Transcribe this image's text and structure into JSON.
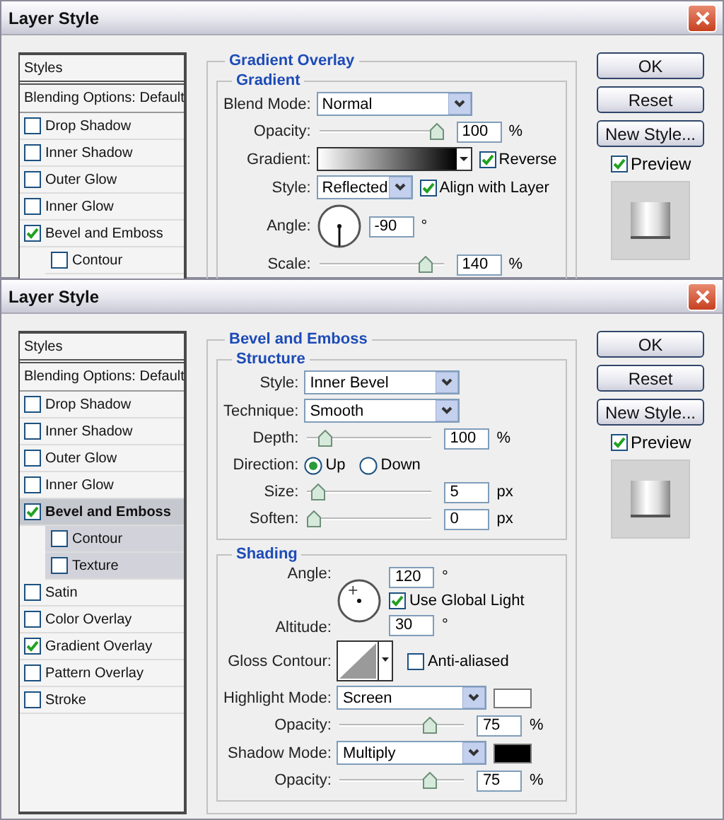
{
  "dialogs": [
    {
      "title": "Layer Style",
      "styles": [
        {
          "kind": "header",
          "label": "Styles"
        },
        {
          "kind": "plain",
          "label": "Blending Options: Default"
        },
        {
          "kind": "check",
          "label": "Drop Shadow",
          "checked": false,
          "selected": false
        },
        {
          "kind": "check",
          "label": "Inner Shadow",
          "checked": false,
          "selected": false
        },
        {
          "kind": "check",
          "label": "Outer Glow",
          "checked": false,
          "selected": false
        },
        {
          "kind": "check",
          "label": "Inner Glow",
          "checked": false,
          "selected": false
        },
        {
          "kind": "check",
          "label": "Bevel and Emboss",
          "checked": true,
          "selected": false,
          "children": [
            {
              "kind": "check",
              "label": "Contour",
              "checked": false,
              "selected": false
            }
          ]
        }
      ],
      "panel": {
        "title": "Gradient Overlay",
        "groups": [
          {
            "title": "Gradient",
            "rows": [
              {
                "kind": "select",
                "label": "Blend Mode:",
                "value": "Normal"
              },
              {
                "kind": "slider",
                "label": "Opacity:",
                "level": 1,
                "value": "100",
                "unit": "%"
              },
              {
                "kind": "gradient",
                "label": "Gradient:",
                "option": {
                  "label": "Reverse",
                  "checked": true
                }
              },
              {
                "kind": "select",
                "label": "Style:",
                "value": "Reflected",
                "option": {
                  "label": "Align with Layer",
                  "checked": true
                }
              },
              {
                "kind": "angle",
                "label": "Angle:",
                "value": "-90",
                "unit": "°"
              },
              {
                "kind": "slider",
                "label": "Scale:",
                "level": 0.9,
                "value": "140",
                "unit": "%"
              }
            ]
          }
        ]
      },
      "buttons": [
        "OK",
        "Reset",
        "New Style..."
      ],
      "preview": {
        "label": "Preview",
        "checked": true
      }
    },
    {
      "title": "Layer Style",
      "styles": [
        {
          "kind": "header",
          "label": "Styles"
        },
        {
          "kind": "plain",
          "label": "Blending Options: Default"
        },
        {
          "kind": "check",
          "label": "Drop Shadow",
          "checked": false,
          "selected": false
        },
        {
          "kind": "check",
          "label": "Inner Shadow",
          "checked": false,
          "selected": false
        },
        {
          "kind": "check",
          "label": "Outer Glow",
          "checked": false,
          "selected": false
        },
        {
          "kind": "check",
          "label": "Inner Glow",
          "checked": false,
          "selected": false
        },
        {
          "kind": "check",
          "label": "Bevel and Emboss",
          "checked": true,
          "selected": true,
          "children": [
            {
              "kind": "check",
              "label": "Contour",
              "checked": false,
              "selected": false
            },
            {
              "kind": "check",
              "label": "Texture",
              "checked": false,
              "selected": false
            }
          ]
        },
        {
          "kind": "check",
          "label": "Satin",
          "checked": false,
          "selected": false
        },
        {
          "kind": "check",
          "label": "Color Overlay",
          "checked": false,
          "selected": false
        },
        {
          "kind": "check",
          "label": "Gradient Overlay",
          "checked": true,
          "selected": false
        },
        {
          "kind": "check",
          "label": "Pattern Overlay",
          "checked": false,
          "selected": false
        },
        {
          "kind": "check",
          "label": "Stroke",
          "checked": false,
          "selected": false
        }
      ],
      "panel": {
        "title": "Bevel and Emboss",
        "groups": [
          {
            "title": "Structure",
            "rows": [
              {
                "kind": "select",
                "label": "Style:",
                "value": "Inner Bevel"
              },
              {
                "kind": "select",
                "label": "Technique:",
                "value": "Smooth"
              },
              {
                "kind": "slider",
                "label": "Depth:",
                "level": 0.1,
                "value": "100",
                "unit": "%"
              },
              {
                "kind": "radio",
                "label": "Direction:",
                "options": [
                  {
                    "label": "Up",
                    "selected": true
                  },
                  {
                    "label": "Down",
                    "selected": false
                  }
                ]
              },
              {
                "kind": "slider",
                "label": "Size:",
                "level": 0.03,
                "value": "5",
                "unit": "px"
              },
              {
                "kind": "slider",
                "label": "Soften:",
                "level": 0,
                "value": "0",
                "unit": "px"
              }
            ]
          },
          {
            "title": "Shading",
            "rows": [
              {
                "kind": "light",
                "angle": {
                  "label": "Angle:",
                  "value": "120",
                  "unit": "°"
                },
                "option": {
                  "label": "Use Global Light",
                  "checked": true
                },
                "altitude": {
                  "label": "Altitude:",
                  "value": "30",
                  "unit": "°"
                }
              },
              {
                "kind": "contour",
                "label": "Gloss Contour:",
                "option": {
                  "label": "Anti-aliased",
                  "checked": false
                }
              },
              {
                "kind": "select",
                "label": "Highlight Mode:",
                "value": "Screen",
                "color": "#ffffff"
              },
              {
                "kind": "slider",
                "label": "Opacity:",
                "level": 0.75,
                "value": "75",
                "unit": "%"
              },
              {
                "kind": "select",
                "label": "Shadow Mode:",
                "value": "Multiply",
                "color": "#000000"
              },
              {
                "kind": "slider",
                "label": "Opacity:",
                "level": 0.75,
                "value": "75",
                "unit": "%"
              }
            ]
          }
        ]
      },
      "buttons": [
        "OK",
        "Reset",
        "New Style..."
      ],
      "preview": {
        "label": "Preview",
        "checked": true
      }
    }
  ]
}
